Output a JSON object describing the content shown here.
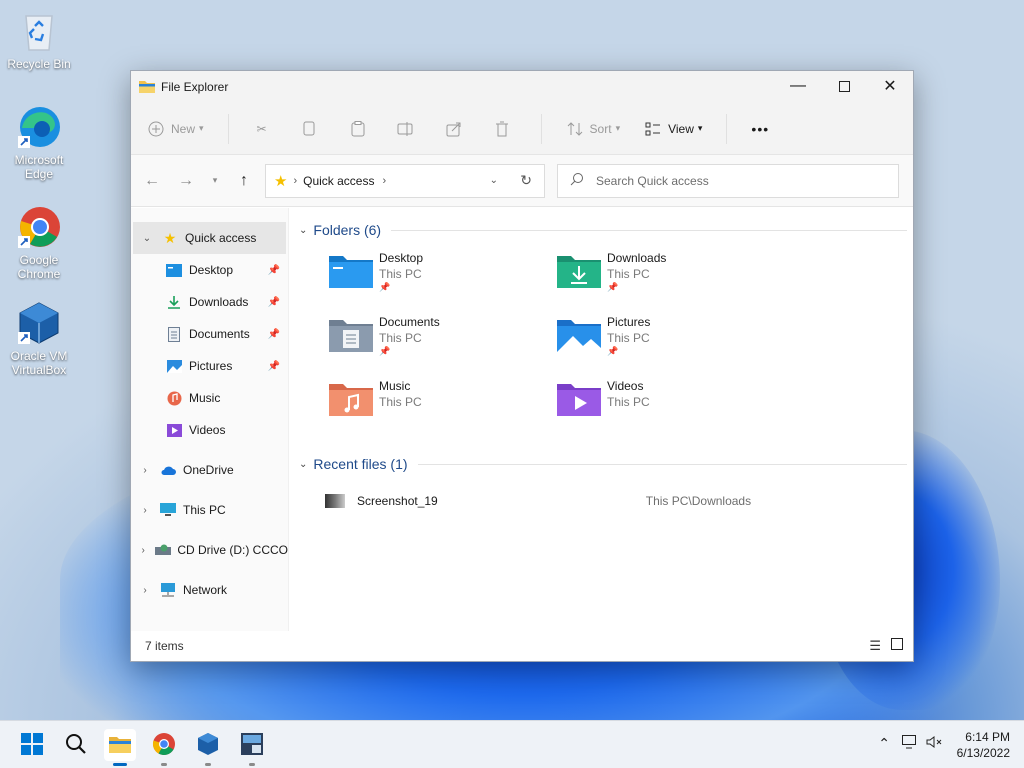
{
  "desktop": {
    "icons": [
      {
        "label": "Recycle Bin"
      },
      {
        "label": "Microsoft Edge"
      },
      {
        "label": "Google Chrome"
      },
      {
        "label": "Oracle VM VirtualBox"
      }
    ]
  },
  "window": {
    "title": "File Explorer",
    "toolbar": {
      "new_label": "New",
      "sort_label": "Sort",
      "view_label": "View",
      "more_label": "•••"
    },
    "address": {
      "crumb": "Quick access",
      "search_placeholder": "Search Quick access"
    },
    "sidebar": {
      "quick_access": "Quick access",
      "items": [
        {
          "label": "Desktop"
        },
        {
          "label": "Downloads"
        },
        {
          "label": "Documents"
        },
        {
          "label": "Pictures"
        },
        {
          "label": "Music"
        },
        {
          "label": "Videos"
        }
      ],
      "onedrive": "OneDrive",
      "thispc": "This PC",
      "cddrive": "CD Drive (D:) CCCO",
      "network": "Network"
    },
    "folders_header": "Folders (6)",
    "folders": [
      {
        "name": "Desktop",
        "loc": "This PC",
        "pinned": true
      },
      {
        "name": "Downloads",
        "loc": "This PC",
        "pinned": true
      },
      {
        "name": "Documents",
        "loc": "This PC",
        "pinned": true
      },
      {
        "name": "Pictures",
        "loc": "This PC",
        "pinned": true
      },
      {
        "name": "Music",
        "loc": "This PC",
        "pinned": false
      },
      {
        "name": "Videos",
        "loc": "This PC",
        "pinned": false
      }
    ],
    "recent_header": "Recent files (1)",
    "recent": [
      {
        "name": "Screenshot_19",
        "path": "This PC\\Downloads"
      }
    ],
    "status": "7 items"
  },
  "taskbar": {
    "time": "6:14 PM",
    "date": "6/13/2022"
  },
  "colors": {
    "accent": "#0067c0",
    "section_header": "#1f4a8a"
  }
}
